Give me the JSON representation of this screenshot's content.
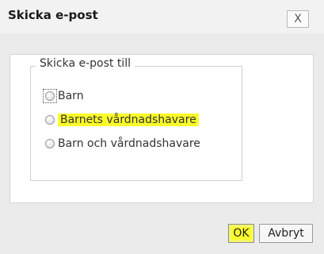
{
  "dialog": {
    "title": "Skicka e-post",
    "close_label": "X"
  },
  "form": {
    "legend": "Skicka e-post till",
    "options": [
      {
        "label": "Barn"
      },
      {
        "label": "Barnets vårdnadshavare"
      },
      {
        "label": "Barn och vårdnadshavare"
      }
    ]
  },
  "buttons": {
    "ok": "OK",
    "cancel": "Avbryt"
  },
  "colors": {
    "highlight": "#fbfb2a"
  }
}
